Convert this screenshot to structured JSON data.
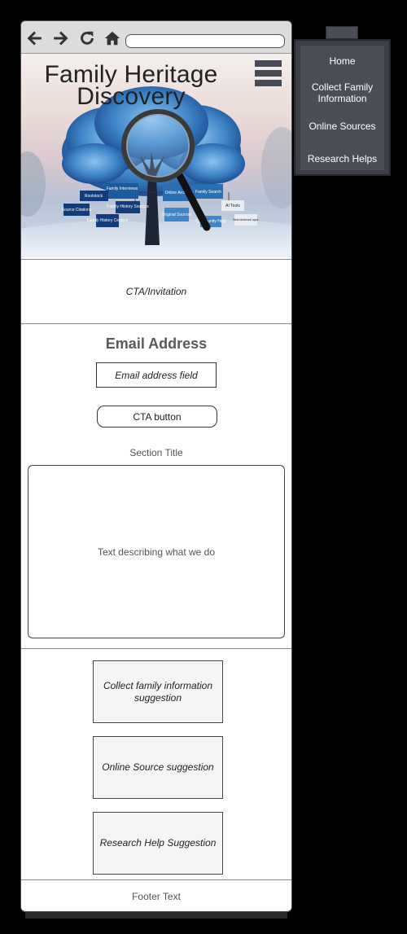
{
  "browser": {
    "back_icon": "arrow-left-icon",
    "forward_icon": "arrow-right-icon",
    "reload_icon": "reload-icon",
    "home_icon": "home-icon",
    "url": ""
  },
  "hero": {
    "title_line1": "Family Heritage",
    "title_line2": "Discovery",
    "tree_labels": [
      "Family Interviews",
      "Rootstock",
      "Source Citations",
      "Family History Centers",
      "Family History Sources",
      "Online Archives",
      "Family Search",
      "Original Sources",
      "AI Tools",
      "Community Help",
      "Best landmark apps"
    ]
  },
  "cta": {
    "text": "CTA/Invitation"
  },
  "email": {
    "title": "Email Address",
    "field_placeholder": "Email address field",
    "button_label": "CTA button"
  },
  "about": {
    "section_title": "Section Title",
    "body": "Text describing what we do"
  },
  "suggestions": [
    {
      "label": "Collect family information suggestion"
    },
    {
      "label": "Online Source suggestion"
    },
    {
      "label": "Research Help Suggestion"
    }
  ],
  "footer": {
    "text": "Footer Text"
  },
  "menu": {
    "items": [
      {
        "label": "Home"
      },
      {
        "label": "Collect Family Information"
      },
      {
        "label": "Online Sources"
      },
      {
        "label": "Research Helps"
      }
    ]
  },
  "colors": {
    "menu_bg": "#4a4f57",
    "tree_blue": "#3f86c9",
    "box_navy": "#123d7a"
  }
}
